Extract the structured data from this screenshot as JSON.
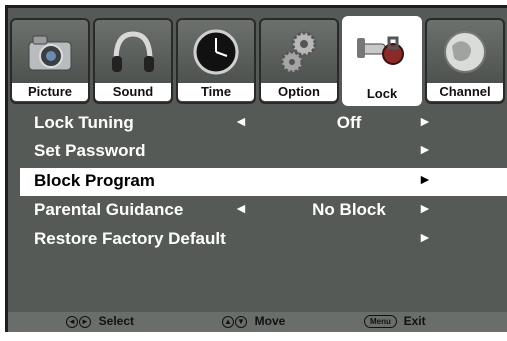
{
  "tabs": [
    {
      "label": "Picture",
      "icon": "camera-icon",
      "active": false
    },
    {
      "label": "Sound",
      "icon": "headphones-icon",
      "active": false
    },
    {
      "label": "Time",
      "icon": "clock-icon",
      "active": false
    },
    {
      "label": "Option",
      "icon": "gears-icon",
      "active": false
    },
    {
      "label": "Lock",
      "icon": "key-lock-icon",
      "active": true
    },
    {
      "label": "Channel",
      "icon": "globe-icon",
      "active": false
    }
  ],
  "menu": {
    "items": [
      {
        "label": "Lock Tuning",
        "value": "Off",
        "left_arrow": "◄",
        "right_arrow": "►"
      },
      {
        "label": "Set Password",
        "value": "",
        "left_arrow": "",
        "right_arrow": "►"
      },
      {
        "label": "Block Program",
        "value": "",
        "left_arrow": "",
        "right_arrow": "►",
        "selected": true
      },
      {
        "label": "Parental Guidance",
        "value": "No Block",
        "left_arrow": "◄",
        "right_arrow": "►"
      },
      {
        "label": "Restore Factory Default",
        "value": "",
        "left_arrow": "",
        "right_arrow": "►"
      }
    ]
  },
  "footer": {
    "select_label": "Select",
    "move_label": "Move",
    "menu_key": "Menu",
    "exit_label": "Exit"
  },
  "colors": {
    "panel": "#555a56",
    "highlight": "#ffffff",
    "text": "#ffffff"
  }
}
